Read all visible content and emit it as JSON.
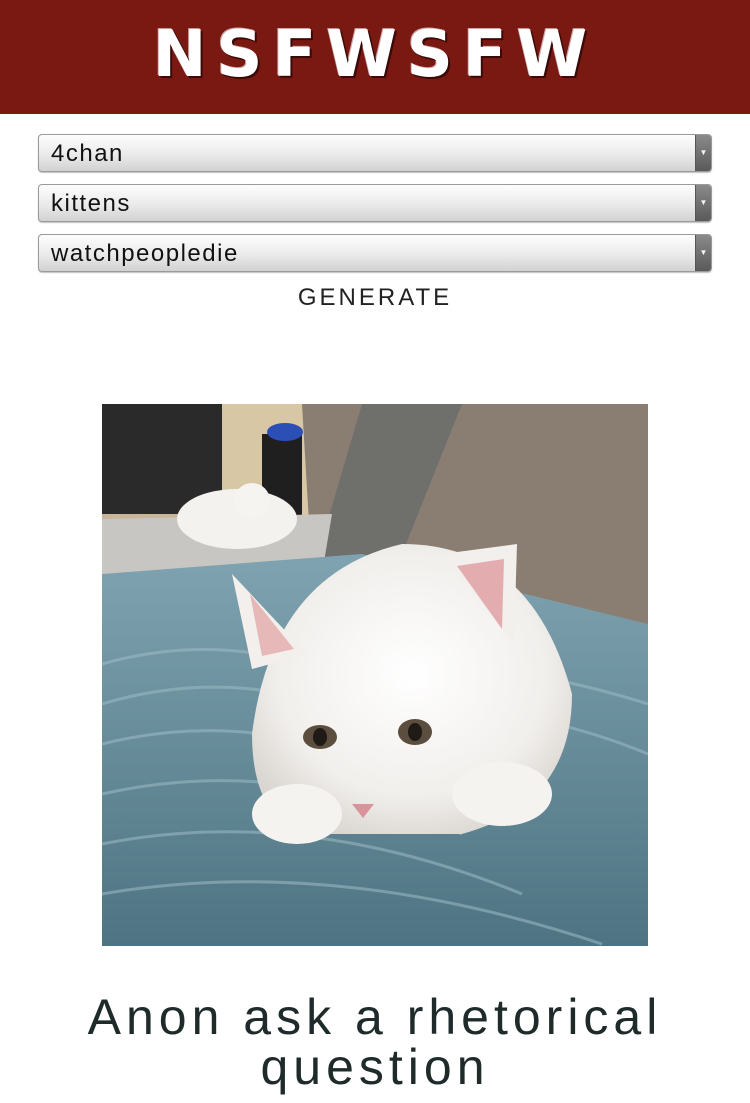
{
  "header": {
    "logo_text": "NSFWSFW"
  },
  "selects": [
    {
      "value": "4chan"
    },
    {
      "value": "kittens"
    },
    {
      "value": "watchpeopledie"
    }
  ],
  "generate_label": "GENERATE",
  "caption": "Anon ask a rhetorical question",
  "colors": {
    "header_bg": "#7a1812",
    "caption_text": "#1f2a2a"
  },
  "icons": {
    "select_arrow": "chevron-down-icon"
  }
}
